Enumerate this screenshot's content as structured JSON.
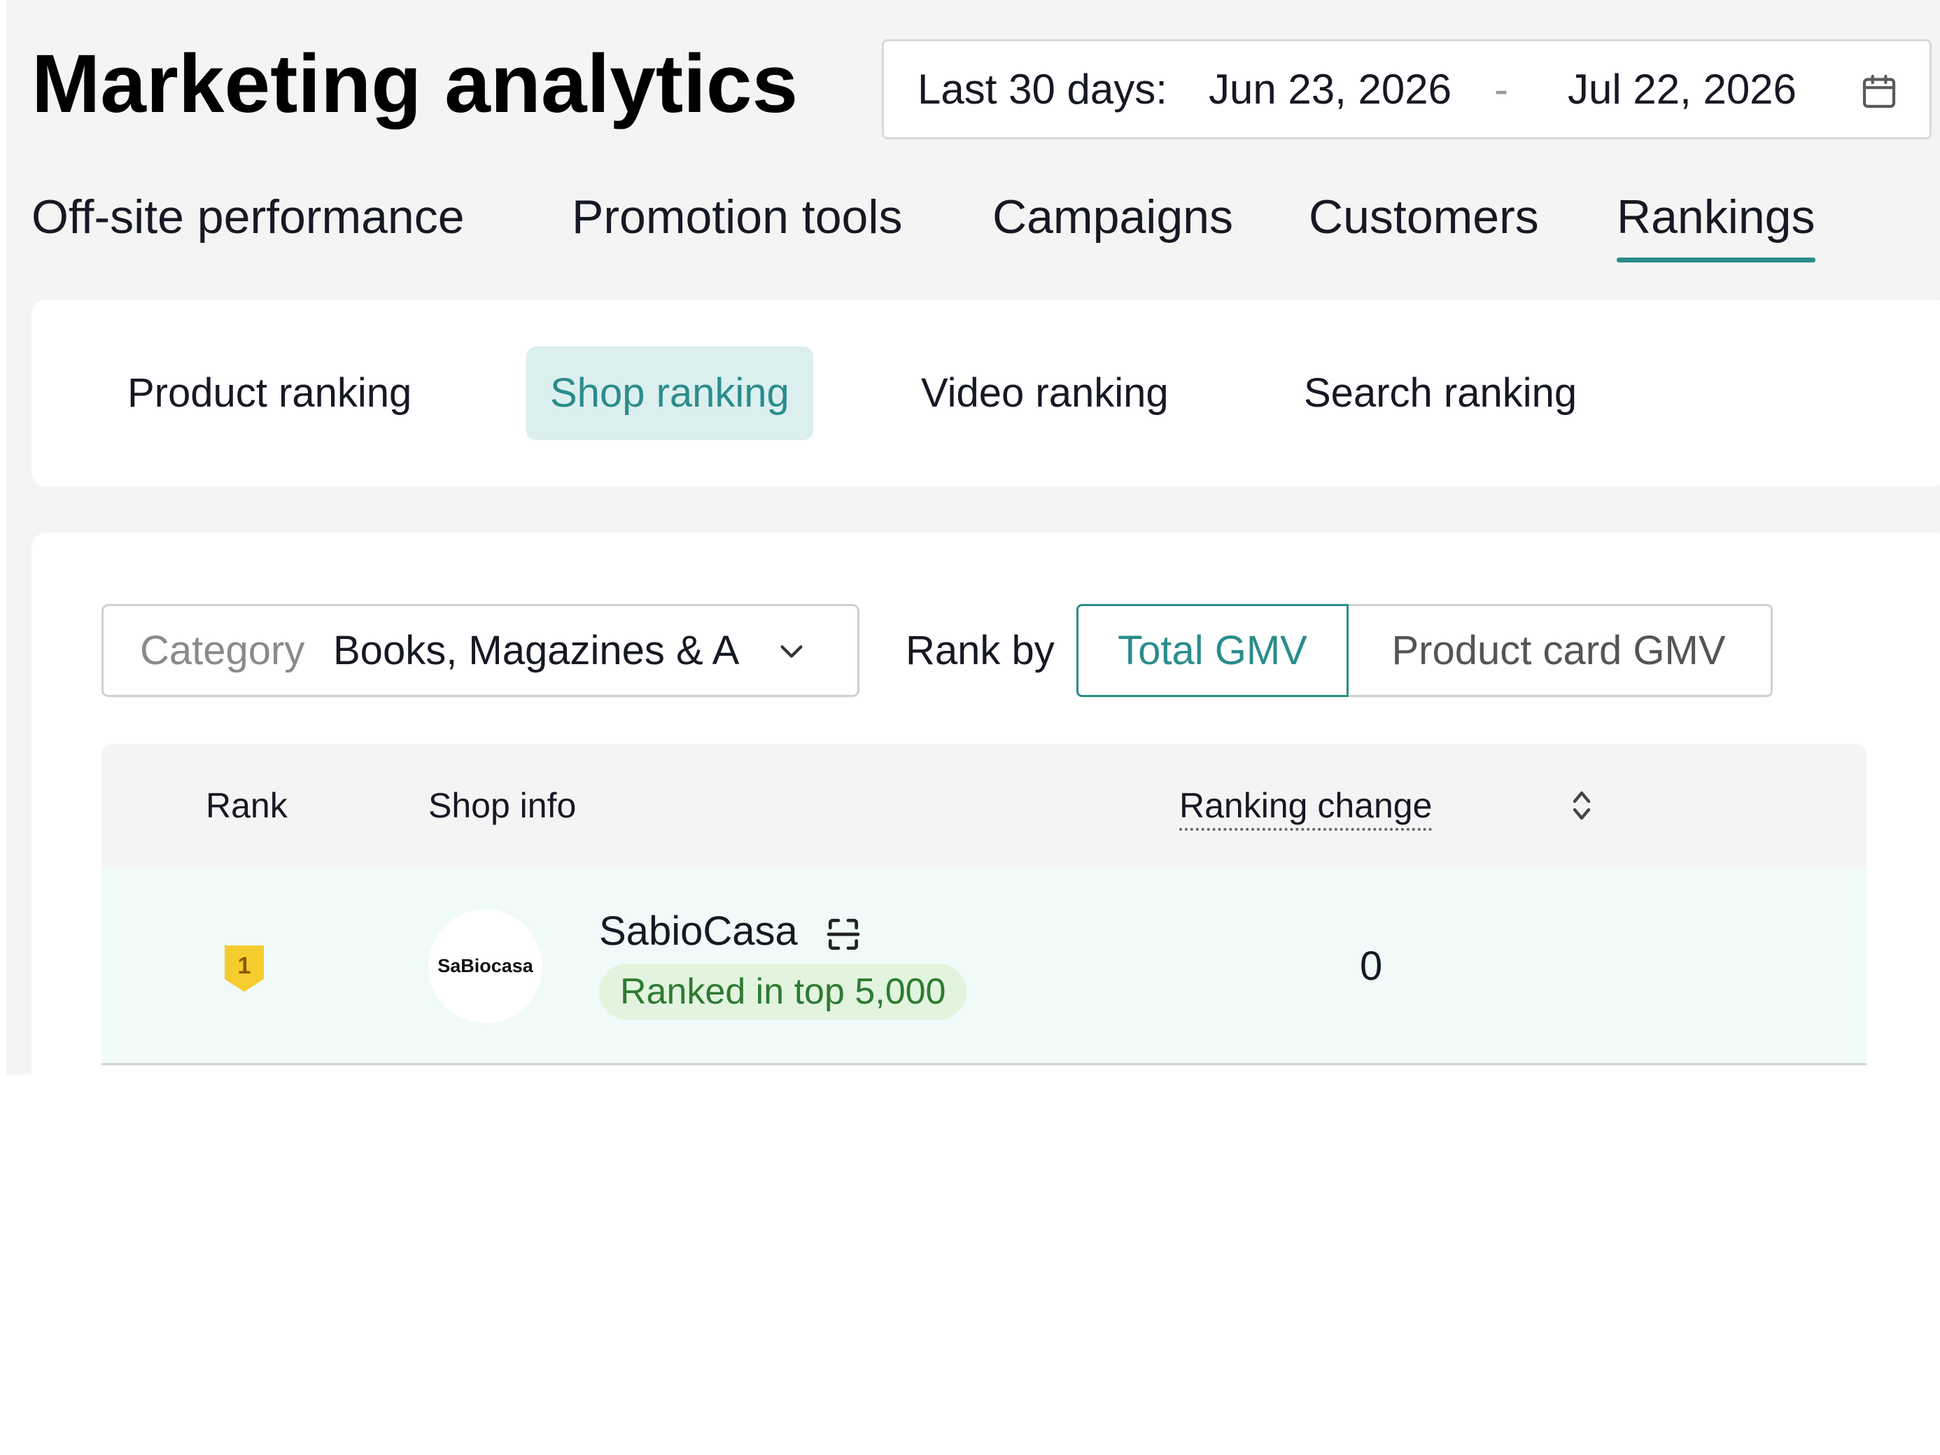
{
  "page_title": "Marketing analytics",
  "date_range": {
    "label": "Last 30 days:",
    "start": "Jun 23, 2026",
    "separator": "-",
    "end": "Jul 22, 2026",
    "icon": "calendar-icon"
  },
  "main_tabs": [
    {
      "label": "Off-site performance",
      "active": false
    },
    {
      "label": "Promotion tools",
      "active": false
    },
    {
      "label": "Campaigns",
      "active": false
    },
    {
      "label": "Customers",
      "active": false
    },
    {
      "label": "Rankings",
      "active": true
    }
  ],
  "sub_tabs": [
    {
      "label": "Product ranking",
      "active": false
    },
    {
      "label": "Shop ranking",
      "active": true
    },
    {
      "label": "Video ranking",
      "active": false
    },
    {
      "label": "Search ranking",
      "active": false
    }
  ],
  "filters": {
    "category_label": "Category",
    "category_value": "Books, Magazines & A",
    "rank_by_label": "Rank by",
    "rank_by_options": [
      {
        "label": "Total GMV",
        "selected": true
      },
      {
        "label": "Product card GMV",
        "selected": false
      }
    ]
  },
  "table": {
    "columns": {
      "rank": "Rank",
      "shop_info": "Shop info",
      "ranking_change": "Ranking change"
    },
    "rows": [
      {
        "rank": "1",
        "shop_name": "SabioCasa",
        "logo_text": "SaBiocasa",
        "tag": "Ranked in top 5,000",
        "ranking_change": "0"
      }
    ]
  },
  "colors": {
    "accent": "#2b8c8c",
    "active_subtab_bg": "#dcefef",
    "row_highlight": "#effaf9",
    "tag_bg": "#e2f4de",
    "tag_text": "#2e7a33",
    "rank_badge": "#f6cd2e"
  }
}
